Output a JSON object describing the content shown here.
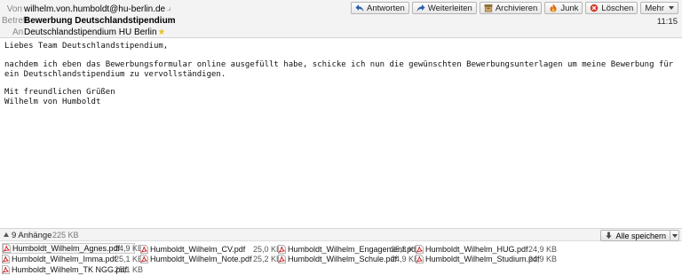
{
  "header": {
    "from_label": "Von",
    "from_value": "wilhelm.von.humboldt@hu-berlin.de",
    "subject_label": "Betreff",
    "subject_value": "Bewerbung Deutschlandstipendium",
    "to_label": "An",
    "to_value": "Deutschlandstipendium HU Berlin",
    "time": "11:15"
  },
  "toolbar": {
    "reply": "Antworten",
    "forward": "Weiterleiten",
    "archive": "Archivieren",
    "junk": "Junk",
    "delete": "Löschen",
    "more": "Mehr"
  },
  "message": {
    "greeting": "Liebes Team Deutschlandstipendium,",
    "paragraph": "nachdem ich eben das Bewerbungsformular online ausgefüllt habe, schicke ich nun die gewünschten Bewerbungsunterlagen um meine Bewerbung für ein Deutschlandstipendium zu vervollständigen.",
    "closing": "Mit freundlichen Grüßen",
    "signature": "Wilhelm von Humboldt"
  },
  "attachments_bar": {
    "count": "9 Anhänge",
    "total_size": "225 KB",
    "save_all": "Alle speichern"
  },
  "attachments": [
    {
      "name": "Humboldt_Wilhelm_Agnes.pdf",
      "size": "24,9 KB"
    },
    {
      "name": "Humboldt_Wilhelm_CV.pdf",
      "size": "25,0 KB"
    },
    {
      "name": "Humboldt_Wilhelm_Engagement.pdf",
      "size": "25,3 KB"
    },
    {
      "name": "Humboldt_Wilhelm_HUG.pdf",
      "size": "24,9 KB"
    },
    {
      "name": "Humboldt_Wilhelm_Imma.pdf",
      "size": "25,1 KB"
    },
    {
      "name": "Humboldt_Wilhelm_Note.pdf",
      "size": "25,2 KB"
    },
    {
      "name": "Humboldt_Wilhelm_Schule.pdf",
      "size": "24,9 KB"
    },
    {
      "name": "Humboldt_Wilhelm_Studium.pdf",
      "size": "24,9 KB"
    },
    {
      "name": "Humboldt_Wilhelm_TK NGG.pdf",
      "size": "25,1 KB"
    }
  ],
  "icons": {
    "reply": "reply-arrow-icon",
    "forward": "forward-arrow-icon",
    "archive": "archive-box-icon",
    "junk": "junk-flame-icon",
    "delete": "delete-icon",
    "attachment": "pdf-file-icon",
    "save_all": "download-arrow-icon",
    "star": "star-icon"
  },
  "colors": {
    "header_bg": "#f3f3f3",
    "star": "#e8c02a",
    "pdf_red": "#cc1f1f"
  }
}
